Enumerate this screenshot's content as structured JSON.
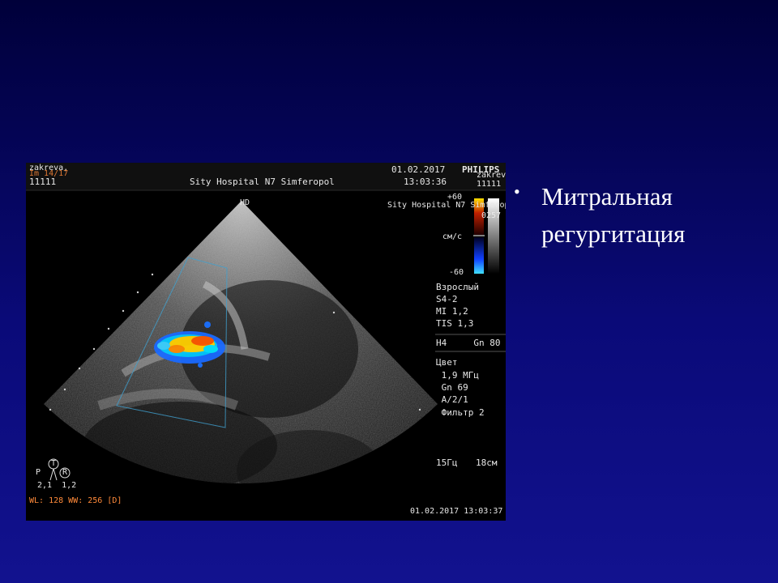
{
  "slide": {
    "bullet_text": "Митральная регургитация",
    "background_color": "#0a0a78",
    "text_color": "#ffffff"
  },
  "ultrasound": {
    "patient_name": "zakreva,",
    "patient_id": "11111",
    "top_left_small": "Im 14/17",
    "hospital": "Sity Hospital N7 Simferopol",
    "date": "01.02.2017",
    "time": "13:03:36",
    "brand": "PHILIPS",
    "overlay_right_name": "zakreva",
    "overlay_right_id": "11111",
    "overlay_right_hospital": "Sity Hospital N7 Simferopol",
    "overlay_right_code": "0257",
    "hd_label": "HD",
    "scale_top": "+60",
    "scale_unit": "см/с",
    "scale_bottom": "-60",
    "info_lines": [
      "Взрослый",
      "S4-2",
      "MI 1,2",
      "TIS 1,3"
    ],
    "mode_line": "H4     Gn 80",
    "color_header": "Цвет",
    "color_lines": [
      " 1,9 МГц",
      " Gn 69",
      " A/2/1",
      " Фильтр 2"
    ],
    "frame_rate": "15Гц",
    "depth": "18см",
    "probe_orientation_top": "T",
    "probe_orientation_left": "P",
    "probe_orientation_right": "R",
    "probe_values": "2,1  1,2",
    "window_level": "WL: 128 WW: 256 [D]",
    "bottom_timestamp": "01.02.2017 13:03:37",
    "doppler_colors": [
      "#ff2a00",
      "#ffb000",
      "#ffee00",
      "#1a8cff",
      "#00d0ff",
      "#1040ff"
    ]
  }
}
